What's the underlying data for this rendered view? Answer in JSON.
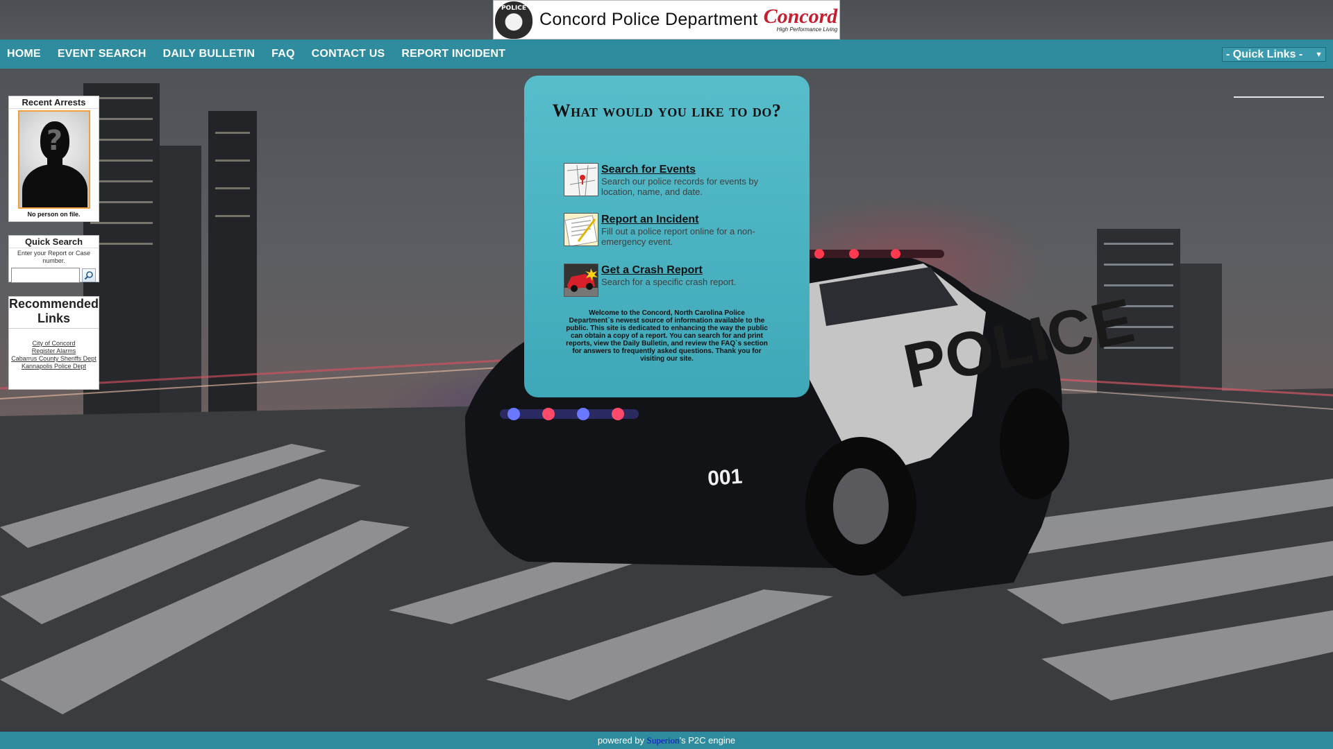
{
  "banner": {
    "badge_text": "POLICE",
    "title": "Concord Police Department",
    "logo_word": "Concord",
    "logo_tagline": "High Performance Living"
  },
  "nav": {
    "items": [
      "HOME",
      "EVENT SEARCH",
      "DAILY BULLETIN",
      "FAQ",
      "CONTACT US",
      "REPORT INCIDENT"
    ],
    "quick_links": "- Quick Links -"
  },
  "sidebar": {
    "recent_arrests": {
      "title": "Recent Arrests",
      "placeholder_symbol": "?",
      "caption": "No person on file."
    },
    "quick_search": {
      "title": "Quick Search",
      "hint": "Enter your Report or Case number.",
      "input_value": ""
    },
    "recommended": {
      "title": "Recommended Links",
      "links": [
        "City of Concord",
        "Register Alarms",
        "Cabarrus County Sheriffs Dept",
        "Kannapolis Police Dept"
      ]
    }
  },
  "panel": {
    "title": "What would you like to do?",
    "actions": [
      {
        "label": "Search for Events",
        "desc": "Search our police records for events by location, name, and date."
      },
      {
        "label": "Report an Incident",
        "desc": "Fill out a police report online for a non-emergency event."
      },
      {
        "label": "Get a Crash Report",
        "desc": "Search for a specific crash report."
      }
    ],
    "welcome": "Welcome to the Concord, North Carolina Police Department`s newest source of information available to the public. This site is dedicated to enhancing the way the public can obtain a copy of a report. You can search for and print reports, view the Daily Bulletin, and review the FAQ`s section for answers to frequently asked questions. Thank you for visiting our site."
  },
  "footer": {
    "prefix": "powered by",
    "brand": "Superion",
    "suffix": "'s P2C engine"
  },
  "colors": {
    "nav": "#2e8c9e",
    "panel": "#4fb6c5",
    "photo_border": "#f0a040",
    "footer_link": "#1010c8"
  }
}
